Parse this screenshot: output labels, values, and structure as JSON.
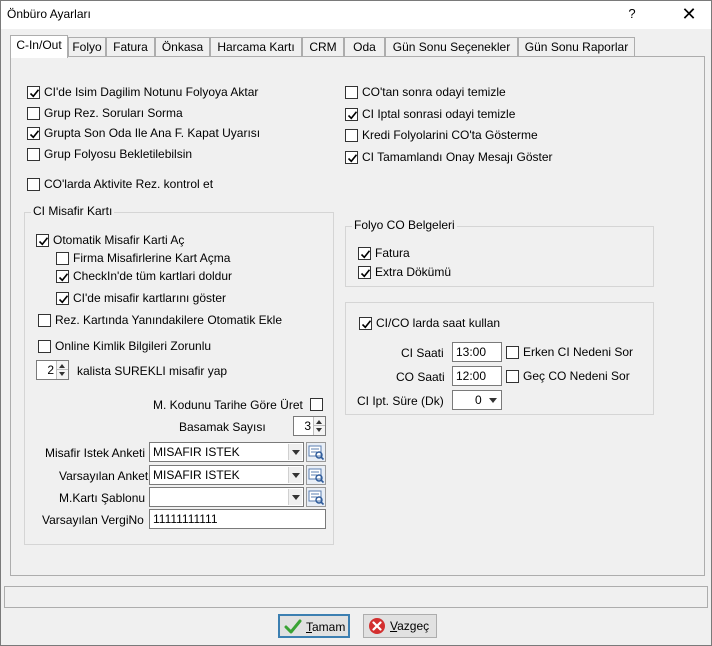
{
  "window": {
    "title": "Önbüro Ayarları",
    "help_glyph": "?",
    "close_glyph": "✕"
  },
  "tabs": [
    {
      "label": "C-In/Out",
      "active": true
    },
    {
      "label": "Folyo"
    },
    {
      "label": "Fatura"
    },
    {
      "label": "Önkasa"
    },
    {
      "label": "Harcama Kartı"
    },
    {
      "label": "CRM"
    },
    {
      "label": "Oda"
    },
    {
      "label": "Gün Sonu Seçenekler"
    },
    {
      "label": "Gün Sonu Raporlar"
    }
  ],
  "left_options": [
    {
      "label": "CI'de Isim Dagilim Notunu Folyoya Aktar",
      "checked": true
    },
    {
      "label": "Grup Rez. Soruları Sorma",
      "checked": false
    },
    {
      "label": "Grupta Son Oda Ile Ana F. Kapat Uyarısı",
      "checked": true
    },
    {
      "label": "Grup Folyosu Bekletilebilsin",
      "checked": false
    },
    {
      "label": "CO'larda Aktivite Rez. kontrol et",
      "checked": false
    }
  ],
  "right_options": [
    {
      "label": "CO'tan sonra odayi temizle",
      "checked": false
    },
    {
      "label": "CI Iptal sonrasi odayi temizle",
      "checked": true
    },
    {
      "label": "Kredi Folyolarini CO'ta Gösterme",
      "checked": false
    },
    {
      "label": "CI Tamamlandı Onay Mesajı Göster",
      "checked": true
    }
  ],
  "ci_card": {
    "title": "CI Misafir Kartı",
    "auto_open": {
      "label": "Otomatik Misafir Karti Aç",
      "checked": true
    },
    "company_no_open": {
      "label": "Firma Misafirlerine Kart Açma",
      "checked": false
    },
    "checkin_fill_all": {
      "label": "CheckIn'de tüm kartlari doldur",
      "checked": true
    },
    "ci_show_cards": {
      "label": "CI'de misafir kartlarını göster",
      "checked": true
    },
    "auto_add_companions": {
      "label": "Rez. Kartında Yanındakilere Otomatik Ekle",
      "checked": false
    },
    "online_id_required": {
      "label": "Online Kimlik Bilgileri Zorunlu",
      "checked": false
    },
    "stay_count": "2",
    "stay_label": "kalista SUREKLI misafir yap",
    "code_by_date": {
      "label": "M. Kodunu Tarihe Göre Üret",
      "checked": false
    },
    "digits_label": "Basamak Sayısı",
    "digits_value": "3",
    "survey_label": "Misafir Istek Anketi",
    "survey_value": "MISAFIR ISTEK",
    "default_survey_label": "Varsayılan Anket",
    "default_survey_value": "MISAFIR ISTEK",
    "template_label": "M.Kartı Şablonu",
    "template_value": "",
    "tax_label": "Varsayılan VergiNo",
    "tax_value": "11111111111"
  },
  "folio_docs": {
    "title": "Folyo CO Belgeleri",
    "invoice": {
      "label": "Fatura",
      "checked": true
    },
    "extra": {
      "label": "Extra Dökümü",
      "checked": true
    }
  },
  "time_group": {
    "use_time": {
      "label": "CI/CO larda saat kullan",
      "checked": true
    },
    "ci_time_label": "CI Saati",
    "ci_time_value": "13:00",
    "early_ci": {
      "label": "Erken CI Nedeni Sor",
      "checked": false
    },
    "co_time_label": "CO Saati",
    "co_time_value": "12:00",
    "late_co": {
      "label": "Geç CO Nedeni Sor",
      "checked": false
    },
    "cancel_label": "CI Ipt. Süre (Dk)",
    "cancel_value": "0"
  },
  "buttons": {
    "ok_first": "T",
    "ok_rest": "amam",
    "cancel_first": "V",
    "cancel_rest": "azgeç"
  },
  "colors": {
    "ok_icon": "#3aa335",
    "cancel_icon": "#d32f2f"
  }
}
